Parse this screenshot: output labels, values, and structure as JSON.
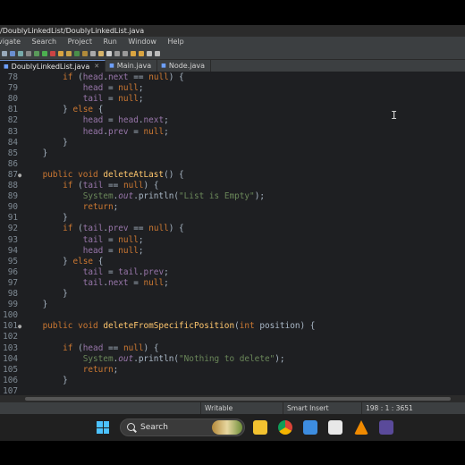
{
  "window": {
    "title": "/DoublyLinkedList/DoublyLinkedList.java"
  },
  "menu": [
    "vigate",
    "Search",
    "Project",
    "Run",
    "Window",
    "Help"
  ],
  "tabs": [
    {
      "label": "DoublyLinkedList.java",
      "active": true
    },
    {
      "label": "Main.java",
      "active": false
    },
    {
      "label": "Node.java",
      "active": false
    }
  ],
  "editor": {
    "lines": [
      {
        "n": "78",
        "mark": "",
        "html": "        <span class=\"kw\">if</span> <span class=\"plain\">(</span><span class=\"field\">head</span><span class=\"plain\">.</span><span class=\"field\">next</span> <span class=\"plain\">==</span> <span class=\"kw\">null</span><span class=\"plain\">) {</span>"
      },
      {
        "n": "79",
        "mark": "",
        "html": "            <span class=\"field\">head</span> <span class=\"plain\">=</span> <span class=\"kw\">null</span><span class=\"plain\">;</span>"
      },
      {
        "n": "80",
        "mark": "",
        "html": "            <span class=\"field\">tail</span> <span class=\"plain\">=</span> <span class=\"kw\">null</span><span class=\"plain\">;</span>"
      },
      {
        "n": "81",
        "mark": "",
        "html": "        <span class=\"plain\">}</span> <span class=\"kw\">else</span> <span class=\"plain\">{</span>"
      },
      {
        "n": "82",
        "mark": "",
        "html": "            <span class=\"field\">head</span> <span class=\"plain\">=</span> <span class=\"field\">head</span><span class=\"plain\">.</span><span class=\"field\">next</span><span class=\"plain\">;</span>"
      },
      {
        "n": "83",
        "mark": "",
        "html": "            <span class=\"field\">head</span><span class=\"plain\">.</span><span class=\"field\">prev</span> <span class=\"plain\">=</span> <span class=\"kw\">null</span><span class=\"plain\">;</span>"
      },
      {
        "n": "84",
        "mark": "",
        "html": "        <span class=\"plain\">}</span>"
      },
      {
        "n": "85",
        "mark": "",
        "html": "    <span class=\"plain\">}</span>"
      },
      {
        "n": "86",
        "mark": "",
        "html": ""
      },
      {
        "n": "87",
        "mark": "●",
        "html": "    <span class=\"kw\">public</span> <span class=\"kw\">void</span> <span class=\"fn\">deleteAtLast</span><span class=\"plain\">() {</span>"
      },
      {
        "n": "88",
        "mark": "",
        "html": "        <span class=\"kw\">if</span> <span class=\"plain\">(</span><span class=\"field\">tail</span> <span class=\"plain\">==</span> <span class=\"kw\">null</span><span class=\"plain\">) {</span>"
      },
      {
        "n": "89",
        "mark": "",
        "html": "            <span class=\"cls\">System</span><span class=\"plain\">.</span><span class=\"it\">out</span><span class=\"plain\">.println(</span><span class=\"str\">\"List is Empty\"</span><span class=\"plain\">);</span>"
      },
      {
        "n": "90",
        "mark": "",
        "html": "            <span class=\"kw\">return</span><span class=\"plain\">;</span>"
      },
      {
        "n": "91",
        "mark": "",
        "html": "        <span class=\"plain\">}</span>"
      },
      {
        "n": "92",
        "mark": "",
        "html": "        <span class=\"kw\">if</span> <span class=\"plain\">(</span><span class=\"field\">tail</span><span class=\"plain\">.</span><span class=\"field\">prev</span> <span class=\"plain\">==</span> <span class=\"kw\">null</span><span class=\"plain\">) {</span>"
      },
      {
        "n": "93",
        "mark": "",
        "html": "            <span class=\"field\">tail</span> <span class=\"plain\">=</span> <span class=\"kw\">null</span><span class=\"plain\">;</span>"
      },
      {
        "n": "94",
        "mark": "",
        "html": "            <span class=\"field\">head</span> <span class=\"plain\">=</span> <span class=\"kw\">null</span><span class=\"plain\">;</span>"
      },
      {
        "n": "95",
        "mark": "",
        "html": "        <span class=\"plain\">}</span> <span class=\"kw\">else</span> <span class=\"plain\">{</span>"
      },
      {
        "n": "96",
        "mark": "",
        "html": "            <span class=\"field\">tail</span> <span class=\"plain\">=</span> <span class=\"field\">tail</span><span class=\"plain\">.</span><span class=\"field\">prev</span><span class=\"plain\">;</span>"
      },
      {
        "n": "97",
        "mark": "",
        "html": "            <span class=\"field\">tail</span><span class=\"plain\">.</span><span class=\"field\">next</span> <span class=\"plain\">=</span> <span class=\"kw\">null</span><span class=\"plain\">;</span>"
      },
      {
        "n": "98",
        "mark": "",
        "html": "        <span class=\"plain\">}</span>"
      },
      {
        "n": "99",
        "mark": "",
        "html": "    <span class=\"plain\">}</span>"
      },
      {
        "n": "100",
        "mark": "",
        "html": ""
      },
      {
        "n": "101",
        "mark": "●",
        "html": "    <span class=\"kw\">public</span> <span class=\"kw\">void</span> <span class=\"fn\">deleteFromSpecificPosition</span><span class=\"plain\">(</span><span class=\"kw\">int</span> <span class=\"plain\">position) {</span>"
      },
      {
        "n": "102",
        "mark": "",
        "html": ""
      },
      {
        "n": "103",
        "mark": "",
        "html": "        <span class=\"kw\">if</span> <span class=\"plain\">(</span><span class=\"field\">head</span> <span class=\"plain\">==</span> <span class=\"kw\">null</span><span class=\"plain\">) {</span>"
      },
      {
        "n": "104",
        "mark": "",
        "html": "            <span class=\"cls\">System</span><span class=\"plain\">.</span><span class=\"it\">out</span><span class=\"plain\">.println(</span><span class=\"str\">\"Nothing to delete\"</span><span class=\"plain\">);</span>"
      },
      {
        "n": "105",
        "mark": "",
        "html": "            <span class=\"kw\">return</span><span class=\"plain\">;</span>"
      },
      {
        "n": "106",
        "mark": "",
        "html": "        <span class=\"plain\">}</span>"
      },
      {
        "n": "107",
        "mark": "",
        "html": ""
      }
    ]
  },
  "status": {
    "writable": "Writable",
    "insert_mode": "Smart Insert",
    "position": "198 : 1 : 3651"
  },
  "taskbar": {
    "search_label": "Search"
  },
  "colors": {
    "editor_bg": "#1e1f22",
    "keyword": "#cc7832",
    "field": "#9876aa",
    "string": "#6a8759",
    "method": "#ffc66d"
  }
}
